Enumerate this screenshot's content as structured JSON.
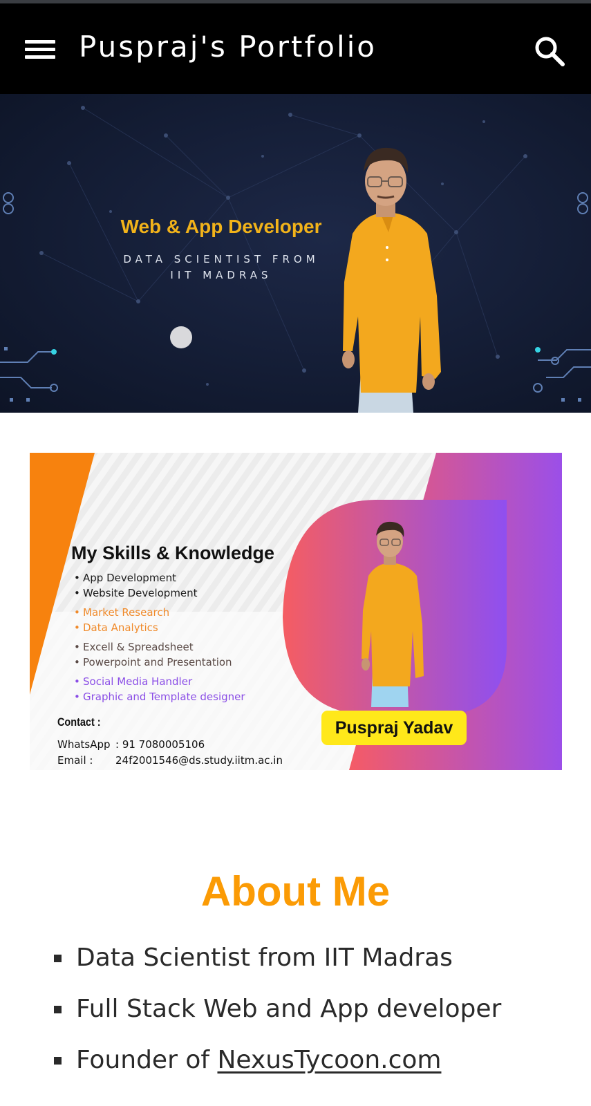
{
  "app_bar": {
    "title": "Puspraj's Portfolio",
    "menu_icon": "hamburger-menu-icon",
    "search_icon": "search-icon"
  },
  "hero": {
    "headline": "Web & App Developer",
    "subtitle_line1": "DATA SCIENTIST FROM",
    "subtitle_line2": "IIT MADRAS",
    "headline_color": "#f2b31a",
    "shirt_color": "#f3a81e"
  },
  "skills_card": {
    "title": "My Skills  & Knowledge",
    "skills": [
      "App Development",
      "Website Development",
      "Market Research",
      "Data Analytics",
      "Excell & Spreadsheet",
      "Powerpoint and Presentation",
      "Social Media Handler",
      "Graphic and Template designer"
    ],
    "contact_label": "Contact :",
    "whatsapp_label": "WhatsApp",
    "whatsapp_value": ": 91 7080005106",
    "email_label": "Email :",
    "email_value": "24f2001546@ds.study.iitm.ac.in",
    "name_badge": "Puspraj Yadav",
    "accent_orange": "#f7820e",
    "gradient_start": "#f55b66",
    "gradient_end": "#9b4fe8"
  },
  "about": {
    "title": "About Me",
    "items": [
      "Data Scientist from IIT Madras",
      "Full Stack Web and App developer"
    ],
    "founder_prefix": "Founder of ",
    "founder_link": "NexusTycoon.com",
    "title_color": "#fb9b05"
  }
}
